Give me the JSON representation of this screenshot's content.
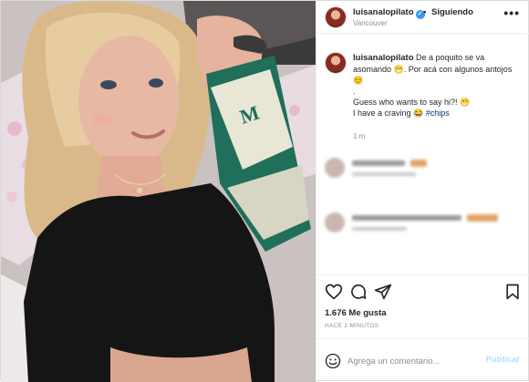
{
  "header": {
    "username": "luisanalopilato",
    "verified_icon": "verified-badge-icon",
    "separator": "•",
    "follow_label": "Siguiendo",
    "location": "Vancouver",
    "more_icon": "more-options-icon"
  },
  "caption": {
    "username": "luisanalopilato",
    "lines": [
      "De a poquito se va asomando 😁. Por acá con algunos antojos ☺️",
      ".",
      "Guess who wants to say hi?! 😁",
      "I have a craving 😂"
    ],
    "hashtag": "#chips",
    "time": "1 m"
  },
  "actions": {
    "like_icon": "heart-icon",
    "comment_icon": "comment-icon",
    "share_icon": "share-icon",
    "save_icon": "bookmark-icon",
    "likes": "1.676 Me gusta",
    "posted": "HACE 2 MINUTOS"
  },
  "comment_box": {
    "emoji_icon": "emoji-icon",
    "placeholder": "Agrega un comentario...",
    "publish_label": "Publicar"
  },
  "colors": {
    "verified": "#3897f0",
    "hashtag": "#00376b",
    "publish_disabled": "#b2dffc",
    "muted": "#8e8e8e"
  }
}
